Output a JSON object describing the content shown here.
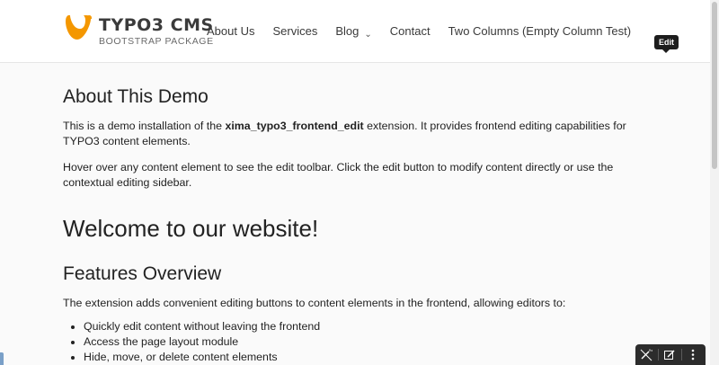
{
  "brand": {
    "title": "TYPO3 CMS",
    "subtitle": "BOOTSTRAP PACKAGE",
    "color": "#f49700"
  },
  "nav": {
    "items": [
      {
        "label": "About Us"
      },
      {
        "label": "Services"
      },
      {
        "label": "Blog",
        "has_dropdown": true
      },
      {
        "label": "Contact"
      },
      {
        "label": "Two Columns (Empty Column Test)"
      }
    ]
  },
  "tooltip": {
    "text": "Edit"
  },
  "content": {
    "about_heading": "About This Demo",
    "about_p1_before": "This is a demo installation of the ",
    "about_p1_bold": "xima_typo3_frontend_edit",
    "about_p1_after": " extension. It provides frontend editing capabilities for TYPO3 content elements.",
    "about_p2": "Hover over any content element to see the edit toolbar. Click the edit button to modify content directly or use the contextual editing sidebar.",
    "welcome_heading": "Welcome to our website!",
    "features_heading": "Features Overview",
    "features_intro": "The extension adds convenient editing buttons to content elements in the frontend, allowing editors to:",
    "features_list": [
      "Quickly edit content without leaving the frontend",
      "Access the page layout module",
      "Hide, move, or delete content elements"
    ]
  },
  "edit_toolbar": {
    "icons": [
      "magic-wand-off-icon",
      "edit-icon",
      "more-vertical-icon"
    ]
  },
  "colors": {
    "toolbar_bg": "#2c2c2c",
    "tooltip_bg": "#1d1d1d",
    "brand_orange": "#f49700"
  }
}
